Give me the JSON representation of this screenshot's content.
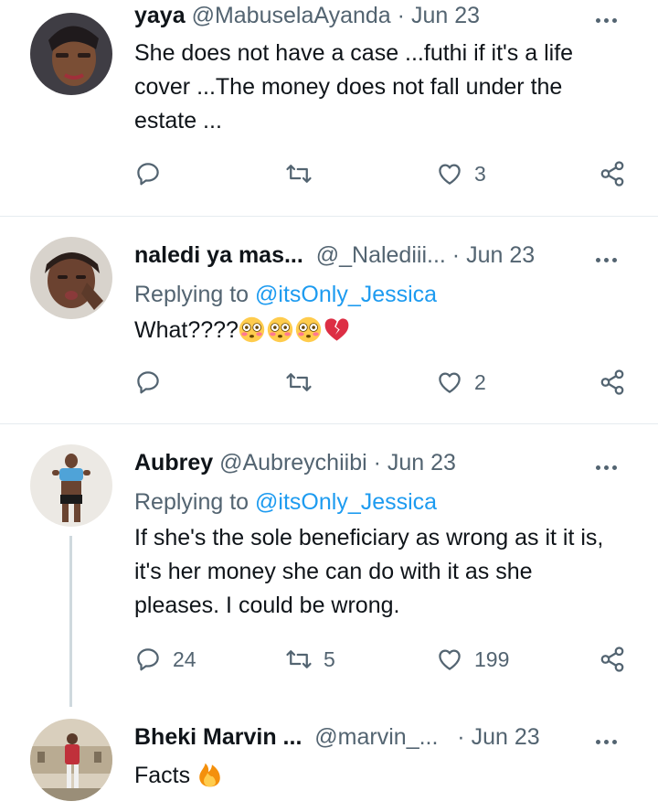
{
  "tweets": [
    {
      "name": "yaya",
      "handle": "@MabuselaAyanda",
      "dot": "·",
      "date": "Jun 23",
      "body": "She does not have a case ...futhi if it's a life cover ...The money does not fall under the estate ...",
      "reply_count": "",
      "retweet_count": "",
      "like_count": "3"
    },
    {
      "name": "naledi ya mas...",
      "handle": "@_Nalediii...",
      "dot": "·",
      "date": "Jun 23",
      "replying_prefix": "Replying to",
      "replying_to": "@itsOnly_Jessica",
      "body": "What????",
      "emojis": [
        "flushed-face",
        "flushed-face",
        "flushed-face",
        "broken-heart"
      ],
      "reply_count": "",
      "retweet_count": "",
      "like_count": "2"
    },
    {
      "name": "Aubrey",
      "handle": "@Aubreychiibi",
      "dot": "·",
      "date": "Jun 23",
      "replying_prefix": "Replying to",
      "replying_to": "@itsOnly_Jessica",
      "body": "If she's the sole beneficiary as wrong as it it is, it's her money she can do with it as she pleases. I could be wrong.",
      "reply_count": "24",
      "retweet_count": "5",
      "like_count": "199"
    },
    {
      "name": "Bheki Marvin ...",
      "handle": "@marvin_...",
      "dot": "·",
      "date": "Jun 23",
      "body": "Facts",
      "emojis": [
        "fire"
      ]
    }
  ],
  "colors": {
    "link": "#1d9bf0",
    "secondary_text": "#536471",
    "divider": "#e6ecf0",
    "broken_heart": "#dd2e44"
  }
}
